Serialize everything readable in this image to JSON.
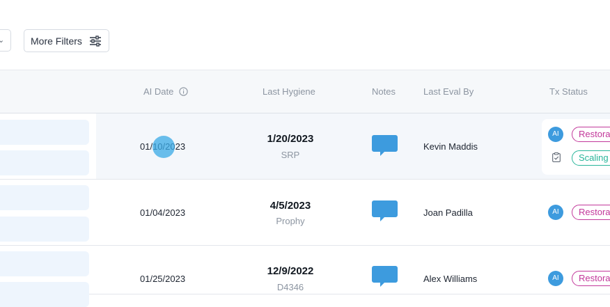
{
  "toolbar": {
    "more_filters_label": "More Filters",
    "dropdown_icon": "chevron-down-icon",
    "filters_icon": "sliders-icon"
  },
  "table": {
    "headers": {
      "ai_date": "AI Date",
      "last_hygiene": "Last Hygiene",
      "notes": "Notes",
      "last_eval_by": "Last Eval By",
      "tx_status": "Tx Status"
    },
    "rows": [
      {
        "ai_date": "01/10/2023",
        "hygiene_date": "1/20/2023",
        "hygiene_type": "SRP",
        "eval_by": "Kevin Maddis",
        "tx": [
          {
            "badge": "AI",
            "status": "Restora"
          },
          {
            "badge": "clipboard-icon",
            "status": "Scaling"
          }
        ]
      },
      {
        "ai_date": "01/04/2023",
        "hygiene_date": "4/5/2023",
        "hygiene_type": "Prophy",
        "eval_by": "Joan Padilla",
        "tx": [
          {
            "badge": "AI",
            "status": "Restora"
          }
        ]
      },
      {
        "ai_date": "01/25/2023",
        "hygiene_date": "12/9/2022",
        "hygiene_type": "D4346",
        "eval_by": "Alex Williams",
        "tx": [
          {
            "badge": "AI",
            "status": "Restora"
          }
        ]
      }
    ]
  },
  "colors": {
    "accent_blue": "#3d9bde",
    "restorative": "#c2379a",
    "scaling": "#28b59a",
    "note_icon": "#3d9bde"
  }
}
